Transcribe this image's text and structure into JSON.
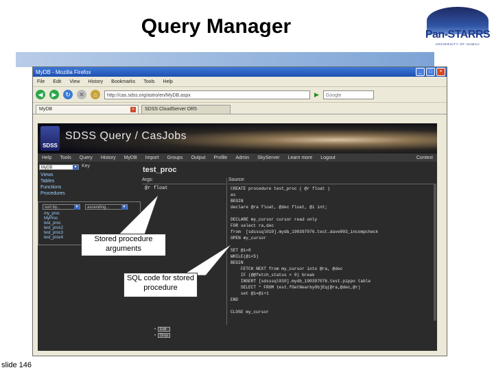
{
  "slide": {
    "title": "Query Manager",
    "slide_number": "slide 146",
    "logo": {
      "word": "Pan-STARRS",
      "sub": "UNIVERSITY OF HAWAII"
    }
  },
  "browser": {
    "window_title": "MyDB - Mozilla Firefox",
    "menu": [
      "File",
      "Edit",
      "View",
      "History",
      "Bookmarks",
      "Tools",
      "Help"
    ],
    "url": "http://cas.sdss.org/astro/en/MyDB.aspx",
    "search_placeholder": "Google",
    "tabs": [
      {
        "label": "MyDB"
      },
      {
        "label": "SDSS CloudServer DR5"
      }
    ]
  },
  "site": {
    "banner_title": "SDSS Query / CasJobs",
    "logo_text": "SDSS",
    "nav": [
      "Help",
      "Tools",
      "Query",
      "History",
      "MyDB",
      "Import",
      "Groups",
      "Output",
      "Profile",
      "Admin",
      "SkyServer",
      "Learn more",
      "Logout"
    ],
    "nav_right": "Context"
  },
  "sidebar": {
    "context_select": "MyDB",
    "key_label": "Key",
    "links": [
      "Views",
      "Tables",
      "Functions",
      "Procedures"
    ],
    "sort_select": "sort by...",
    "order_select": "ascending...",
    "procedures": [
      "my_proc",
      "MyProc",
      "test_proc",
      "test_proc2",
      "test_proc3",
      "test_proc4"
    ]
  },
  "main": {
    "proc_name": "test_proc",
    "args_header": "Args:",
    "source_header": "Source:",
    "arg_value": "@r float",
    "source_code": "CREATE procedure test_proc ( @r float )\nas\nBEGIN\ndeclare @ra float, @dec float, @i int;\n\nDECLARE my_cursor cursor read only\nFOR select ra,dec\nfrom  [sdsssql010].mydb_190397076.test.dave003_incompcheck\nOPEN my_cursor\n\nSET @i=0\nWHILE(@i<5)\nBEGIN\n    FETCH NEXT from my_cursor into @ra, @dec\n    IF (@@fetch_status < 0) break\n    INSERT [sdsssql010].mydb_190397076.test.pippo table\n    SELECT * FROM test.fGetNearbyObjEq(@ra,@dec,@r)\n    set @i=@i+1\nEND\n\nCLOSE my_cursor",
    "actions": [
      "Edit",
      "Drop"
    ]
  },
  "callouts": {
    "args": "Stored procedure arguments",
    "sql": "SQL code for stored procedure"
  },
  "colors": {
    "slide_bar": "#7da4d6",
    "page_bg": "#2b2b2b",
    "link": "#9dd1ff"
  }
}
